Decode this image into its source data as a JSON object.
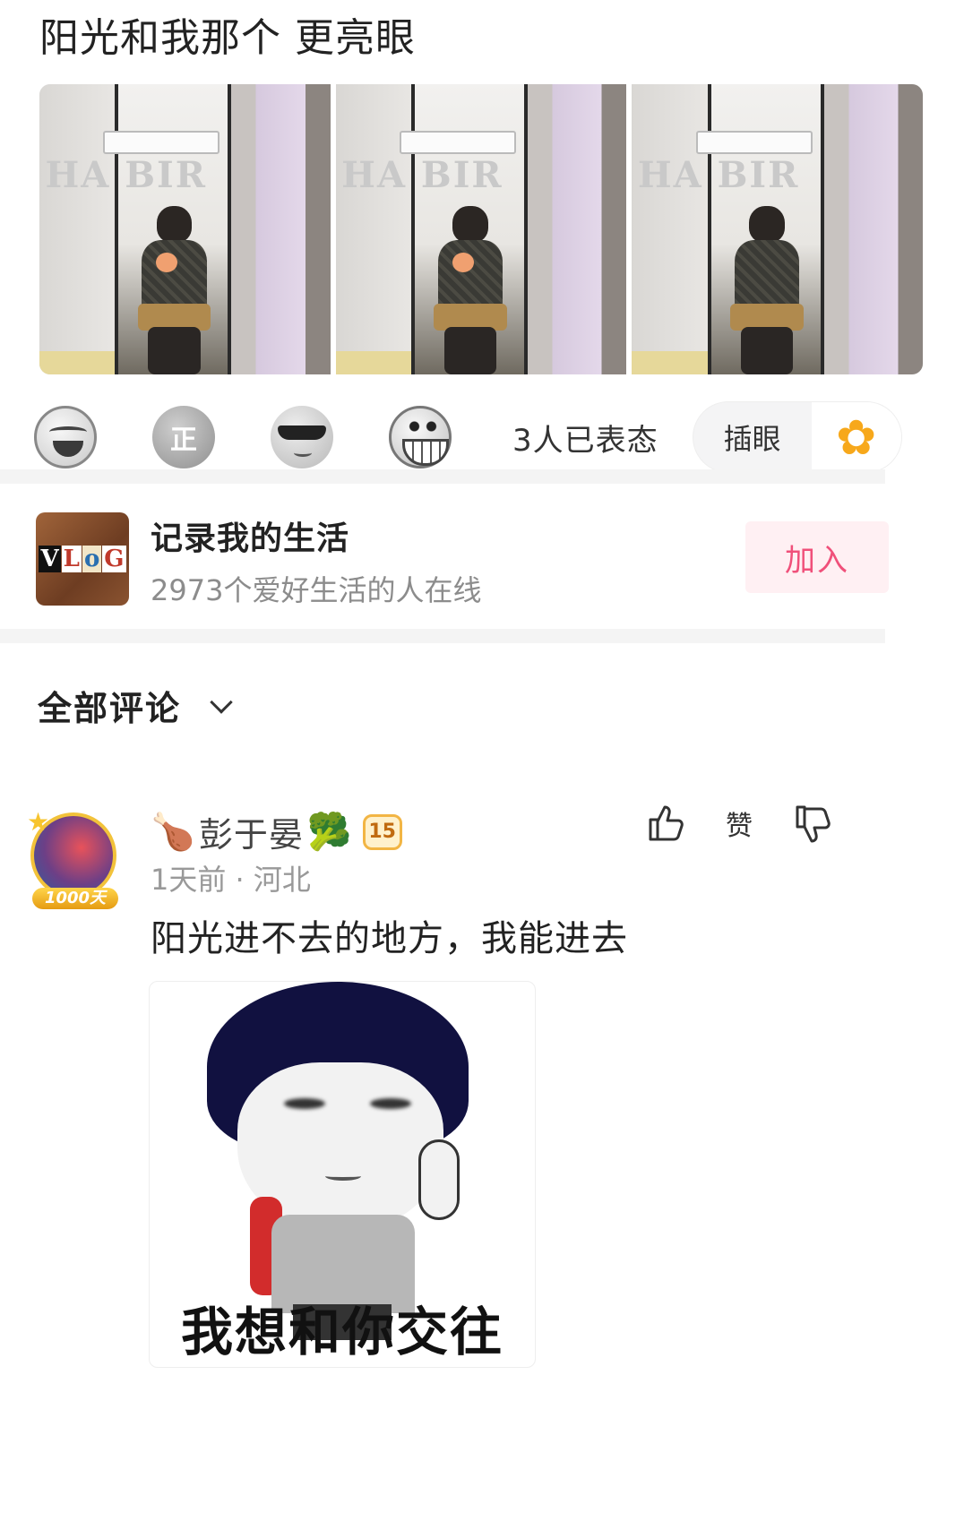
{
  "post": {
    "title": "阳光和我那个 更亮眼",
    "photo_count": 3,
    "photo_balloon_text": "HA BIR"
  },
  "reactions": {
    "icons": [
      "laugh-emoji-icon",
      "zheng-emoji-icon",
      "cool-sunglasses-emoji-icon",
      "grin-emoji-icon"
    ],
    "zheng_glyph": "正",
    "count_text": "3人已表态",
    "chayan_label": "插眼",
    "chayan_icon": "flower-icon"
  },
  "group": {
    "logo_letters": [
      "V",
      "L",
      "o",
      "G"
    ],
    "name": "记录我的生活",
    "subtitle": "2973个爱好生活的人在线",
    "join_label": "加入"
  },
  "comments": {
    "header": "全部评论",
    "items": [
      {
        "avatar_badge": "1000天",
        "username_prefix_emoji": "🍗",
        "username": "彭于晏",
        "username_suffix_emoji": "🥦",
        "level": "15",
        "meta": "1天前 · 河北",
        "text": "阳光进不去的地方，我能进去",
        "like_label": "赞",
        "meme_caption": "我想和你交往"
      }
    ]
  },
  "colors": {
    "accent_pink": "#f0507a",
    "join_bg": "#fff0f3",
    "divider": "#f4f4f4",
    "muted_text": "#8c8c8c"
  }
}
